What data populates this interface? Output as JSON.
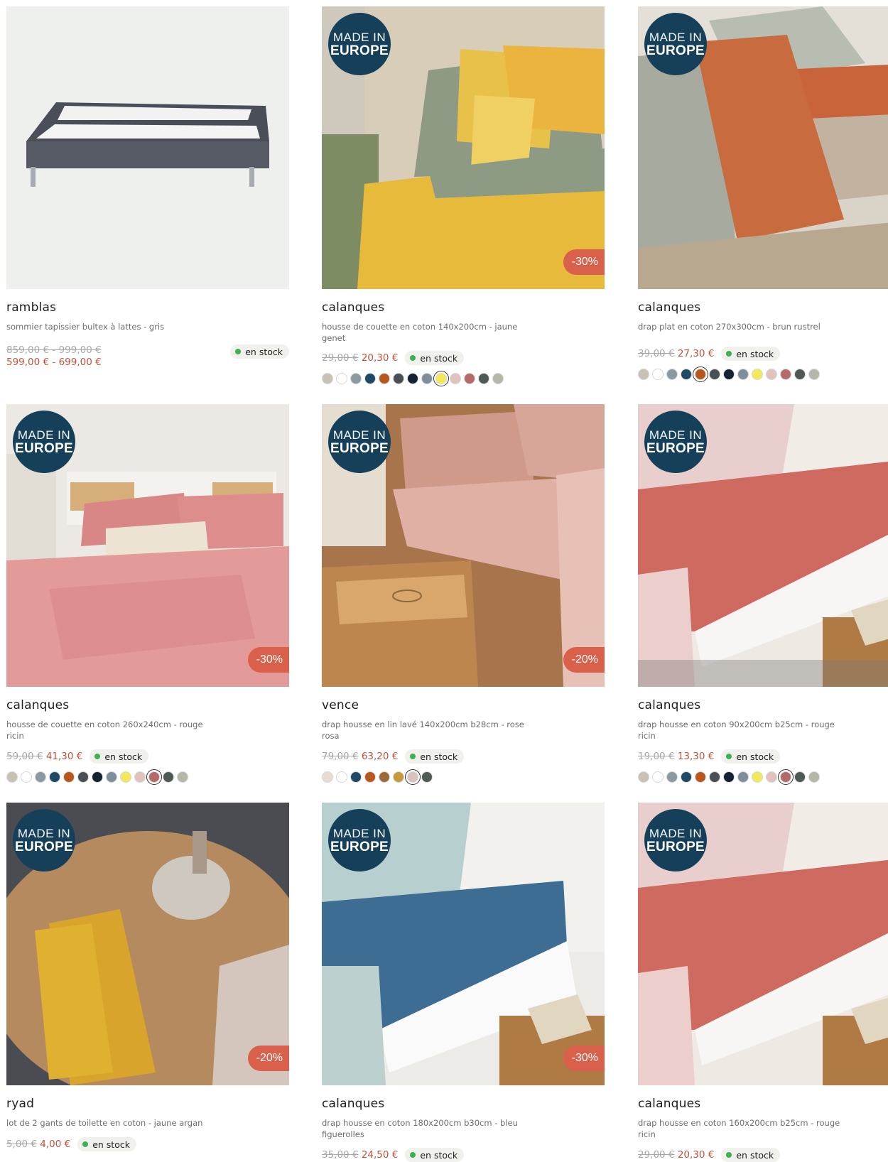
{
  "badge": {
    "line1": "MADE IN",
    "line2": "EUROPE"
  },
  "products": [
    {
      "brand": "ramblas",
      "description": "sommier tapissier bultex à lattes - gris",
      "old_price": "859,00 € - 999,00 €",
      "new_price": "599,00 € - 699,00 €",
      "stock": "en stock",
      "made_in_europe": false,
      "discount": "",
      "swatches": [],
      "selected_swatch": -1
    },
    {
      "brand": "calanques",
      "description": "housse de couette en coton 140x200cm - jaune genet",
      "old_price": "29,00 €",
      "new_price": "20,30 €",
      "stock": "en stock",
      "made_in_europe": true,
      "discount": "-30%",
      "swatches": [
        "#c9c2b4",
        "#ffffff",
        "#8a9aa0",
        "#1f4a66",
        "#b8561c",
        "#4a4e55",
        "#142234",
        "#7d8f9b",
        "#f3e85a",
        "#e1c2bd",
        "#b56a6a",
        "#505a55",
        "#b5b8a8"
      ],
      "selected_swatch": 8
    },
    {
      "brand": "calanques",
      "description": "drap plat en coton 270x300cm - brun rustrel",
      "old_price": "39,00 €",
      "new_price": "27,30 €",
      "stock": "en stock",
      "made_in_europe": true,
      "discount": "",
      "swatches": [
        "#c9c2b4",
        "#ffffff",
        "#8a9aa0",
        "#1f4a66",
        "#b8561c",
        "#4a4e55",
        "#142234",
        "#7d8f9b",
        "#f3e85a",
        "#e1c2bd",
        "#b56a6a",
        "#505a55",
        "#b5b8a8"
      ],
      "selected_swatch": 4
    },
    {
      "brand": "calanques",
      "description": "housse de couette en coton 260x240cm - rouge ricin",
      "old_price": "59,00 €",
      "new_price": "41,30 €",
      "stock": "en stock",
      "made_in_europe": true,
      "discount": "-30%",
      "swatches": [
        "#c9c2b4",
        "#ffffff",
        "#8a9aa0",
        "#1f4a66",
        "#b8561c",
        "#4a4e55",
        "#142234",
        "#7d8f9b",
        "#f3e85a",
        "#e1c2bd",
        "#b56a6a",
        "#505a55",
        "#b5b8a8"
      ],
      "selected_swatch": 10
    },
    {
      "brand": "vence",
      "description": "drap housse en lin lavé 140x200cm b28cm - rose rosa",
      "old_price": "79,00 €",
      "new_price": "63,20 €",
      "stock": "en stock",
      "made_in_europe": true,
      "discount": "-20%",
      "swatches": [
        "#e6dcd0",
        "#ffffff",
        "#1f4a66",
        "#b8561c",
        "#9a6a3a",
        "#c79a3a",
        "#dcc0bd",
        "#505a55"
      ],
      "selected_swatch": 6
    },
    {
      "brand": "calanques",
      "description": "drap housse en coton 90x200cm b25cm - rouge ricin",
      "old_price": "19,00 €",
      "new_price": "13,30 €",
      "stock": "en stock",
      "made_in_europe": true,
      "discount": "",
      "swatches": [
        "#c9c2b4",
        "#ffffff",
        "#8a9aa0",
        "#1f4a66",
        "#b8561c",
        "#4a4e55",
        "#142234",
        "#7d8f9b",
        "#f3e85a",
        "#e1c2bd",
        "#b56a6a",
        "#505a55",
        "#b5b8a8"
      ],
      "selected_swatch": 10
    },
    {
      "brand": "ryad",
      "description": "lot de 2 gants de toilette en coton - jaune argan",
      "old_price": "5,00 €",
      "new_price": "4,00 €",
      "stock": "en stock",
      "made_in_europe": true,
      "discount": "-20%",
      "swatches": [],
      "selected_swatch": -1
    },
    {
      "brand": "calanques",
      "description": "drap housse en coton 180x200cm b30cm - bleu figuerolles",
      "old_price": "35,00 €",
      "new_price": "24,50 €",
      "stock": "en stock",
      "made_in_europe": true,
      "discount": "-30%",
      "swatches": [],
      "selected_swatch": -1
    },
    {
      "brand": "calanques",
      "description": "drap housse en coton 160x200cm b25cm - rouge ricin",
      "old_price": "29,00 €",
      "new_price": "20,30 €",
      "stock": "en stock",
      "made_in_europe": true,
      "discount": "",
      "swatches": [],
      "selected_swatch": -1
    }
  ]
}
